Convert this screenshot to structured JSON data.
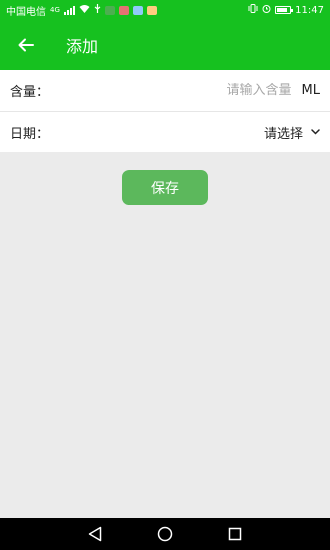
{
  "status_bar": {
    "carrier": "中国电信",
    "network_type": "4G",
    "time": "11:47",
    "icons": [
      "signal-icon",
      "wifi-icon",
      "vibrate-icon",
      "alarm-icon",
      "battery-icon"
    ]
  },
  "header": {
    "title": "添加",
    "back_icon": "arrow-left-icon"
  },
  "form": {
    "amount": {
      "label": "含量：",
      "placeholder": "请输入含量",
      "value": "",
      "unit": "ML"
    },
    "date": {
      "label": "日期：",
      "value": "请选择",
      "icon": "chevron-down-icon"
    }
  },
  "save_button": {
    "label": "保存"
  },
  "nav_bar": {
    "icons": [
      "back-triangle-icon",
      "home-circle-icon",
      "recents-square-icon"
    ]
  },
  "colors": {
    "accent": "#16c11f",
    "button": "#5cb85c",
    "background": "#ebebeb",
    "placeholder": "#a8a8a8"
  }
}
